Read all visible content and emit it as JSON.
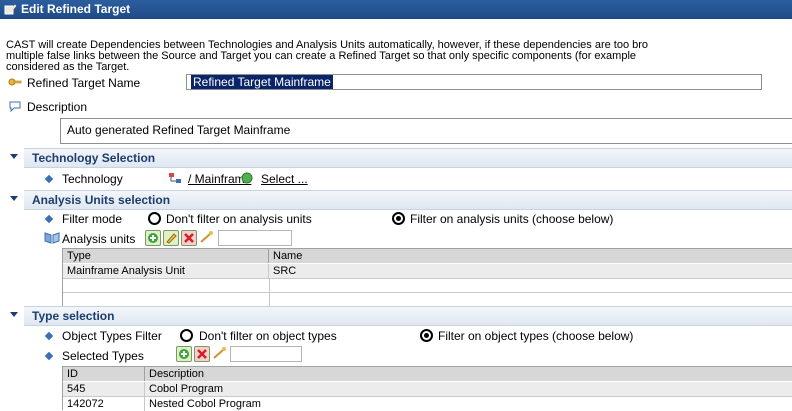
{
  "window": {
    "title": "Edit Refined Target"
  },
  "intro_lines": [
    "CAST will create Dependencies between Technologies and Analysis Units automatically, however, if these dependencies are too bro",
    "multiple false links between the Source and Target you can create a Refined Target so that only specific components (for example",
    "considered as the Target."
  ],
  "refined_target": {
    "label": "Refined Target Name",
    "value": "Refined Target Mainframe"
  },
  "description": {
    "label": "Description",
    "value": "Auto generated Refined Target Mainframe"
  },
  "technology_section": {
    "title": "Technology Selection",
    "label": "Technology",
    "link": "/ Mainframe",
    "select_link": "Select ..."
  },
  "analysis_section": {
    "title": "Analysis Units selection",
    "filter_label": "Filter mode",
    "option_no_filter": "Don't filter on analysis units",
    "option_filter": "Filter on analysis units (choose below)",
    "selected_option": "filter",
    "units_label": "Analysis units",
    "table": {
      "columns": [
        "Type",
        "Name"
      ],
      "rows": [
        [
          "Mainframe Analysis Unit",
          "SRC"
        ]
      ]
    }
  },
  "type_section": {
    "title": "Type selection",
    "filter_label": "Object Types Filter",
    "option_no_filter": "Don't filter on object types",
    "option_filter": "Filter on object types (choose below)",
    "selected_option": "filter",
    "selected_label": "Selected Types",
    "table": {
      "columns": [
        "ID",
        "Description"
      ],
      "rows": [
        [
          "545",
          "Cobol Program"
        ],
        [
          "142072",
          "Nested Cobol Program"
        ]
      ]
    }
  },
  "colors": {
    "title_bar": "#1d4a86",
    "section_text": "#1b3d6e",
    "selection": "#0a246a",
    "table_header": "#d7d7d7"
  }
}
